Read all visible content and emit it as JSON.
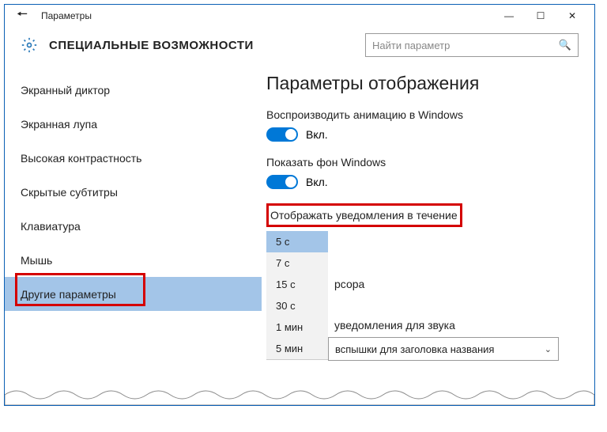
{
  "titlebar": {
    "title": "Параметры"
  },
  "header": {
    "section": "СПЕЦИАЛЬНЫЕ ВОЗМОЖНОСТИ",
    "search_placeholder": "Найти параметр"
  },
  "sidebar": {
    "items": [
      {
        "label": "Экранный диктор"
      },
      {
        "label": "Экранная лупа"
      },
      {
        "label": "Высокая контрастность"
      },
      {
        "label": "Скрытые субтитры"
      },
      {
        "label": "Клавиатура"
      },
      {
        "label": "Мышь"
      },
      {
        "label": "Другие параметры"
      }
    ]
  },
  "main": {
    "heading": "Параметры отображения",
    "anim_label": "Воспроизводить анимацию в Windows",
    "anim_state": "Вкл.",
    "bg_label": "Показать фон Windows",
    "bg_state": "Вкл.",
    "notify_label": "Отображать уведомления в течение",
    "cursor_fragment": "рсора",
    "sound_label": "уведомления для звука",
    "combo_value": "вспышки для заголовка названия"
  },
  "dropdown": {
    "options": [
      {
        "label": "5 с"
      },
      {
        "label": "7 с"
      },
      {
        "label": "15 с"
      },
      {
        "label": "30 с"
      },
      {
        "label": "1 мин"
      },
      {
        "label": "5 мин"
      }
    ]
  }
}
